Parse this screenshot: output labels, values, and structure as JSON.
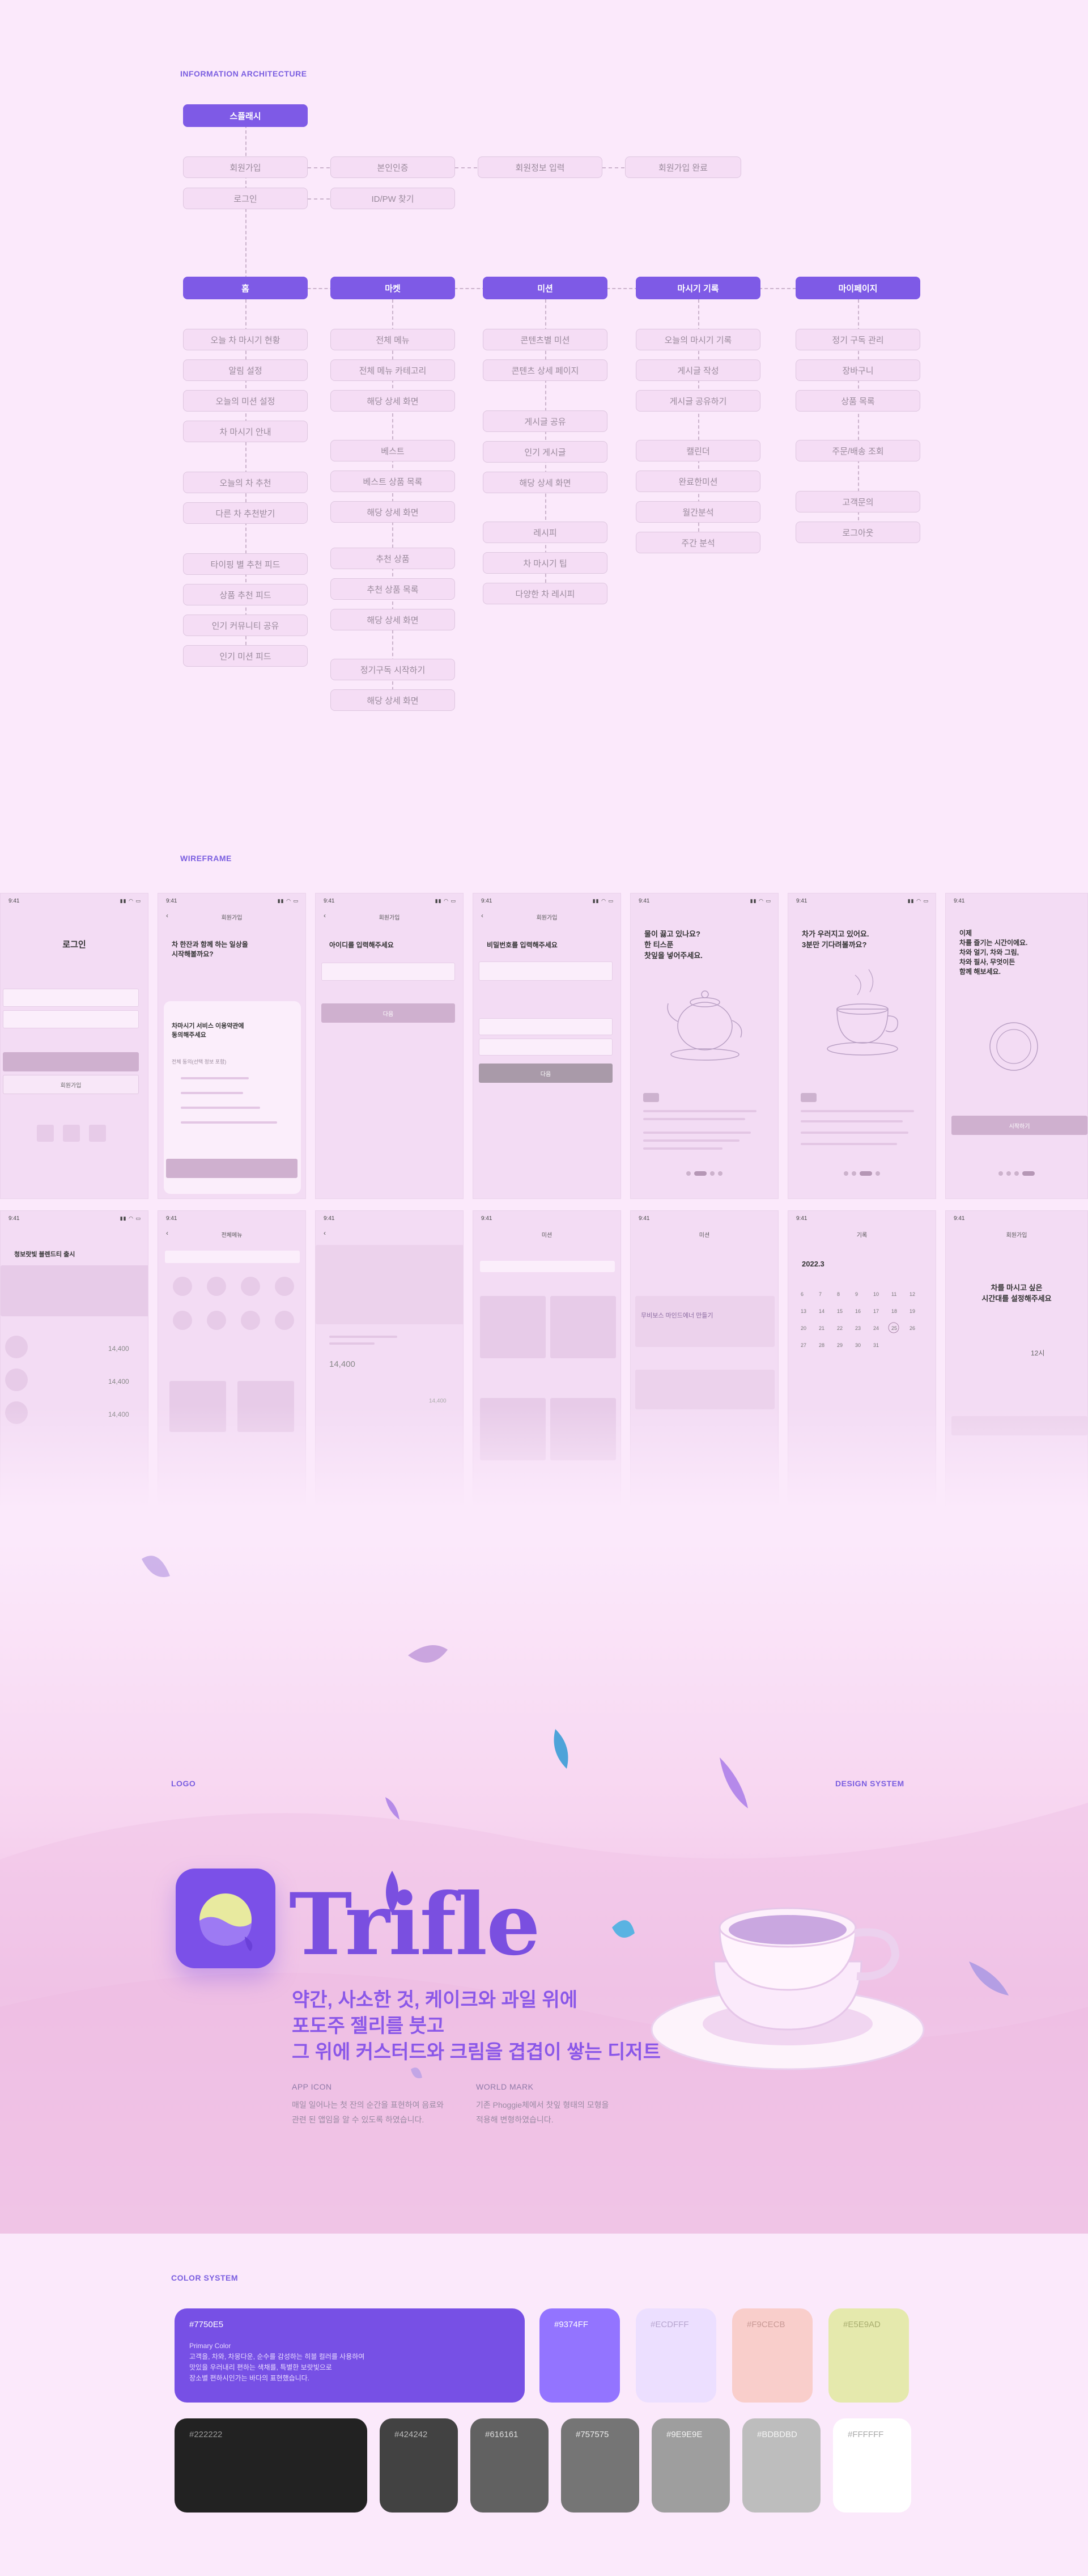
{
  "ia": {
    "label": "INFORMATION ARCHITECTURE",
    "splash": "스플래시",
    "auth_row1": [
      "회원가입",
      "본인인증",
      "회원정보 입력",
      "회원가입 완료"
    ],
    "auth_row2": [
      "로그인",
      "ID/PW 찾기"
    ],
    "columns": [
      {
        "head": "홈",
        "items": [
          "오늘 차 마시기 현황",
          "알림 설정",
          "오늘의 미션 설정",
          "차 마시기 안내",
          "오늘의 차 추천",
          "다른 차 추천받기",
          "타이핑 별 추천 피드",
          "상품 추천 피드",
          "인기 커뮤니티 공유",
          "인기 미션 피드"
        ]
      },
      {
        "head": "마켓",
        "items": [
          "전체 메뉴",
          "전체 메뉴 카테고리",
          "해당 상세 화면",
          "베스트",
          "베스트 상품 목록",
          "해당 상세 화면",
          "추천 상품",
          "추천 상품 목록",
          "해당 상세 화면",
          "정기구독 시작하기",
          "해당 상세 화면"
        ]
      },
      {
        "head": "미션",
        "items": [
          "콘텐츠별 미션",
          "콘텐츠 상세 페이지",
          "게시글 공유",
          "인기 게시글",
          "해당 상세 화면",
          "레시피",
          "차 마시기 팁",
          "다양한 차 레시피"
        ]
      },
      {
        "head": "마시기 기록",
        "items": [
          "오늘의 마시기 기록",
          "게시글 작성",
          "게시글 공유하기",
          "캘린더",
          "완료한미션",
          "월간분석",
          "주간 분석"
        ]
      },
      {
        "head": "마이페이지",
        "items": [
          "정기 구독 관리",
          "장바구니",
          "상품 목록",
          "주문/배송 조회",
          "고객문의",
          "로그아웃"
        ]
      }
    ]
  },
  "wireframe": {
    "label": "WIREFRAME",
    "time": "9:41",
    "login_title": "로그인",
    "signup": "회원가입",
    "join_title": "차 한잔과 함께 하는 일상을\n시작해볼까요?",
    "terms_title": "차마시기 서비스 이용약관에\n동의해주세요",
    "terms_all": "전체 동의(선택 정보 포함)",
    "id_title": "아이디를 입력해주세요",
    "pw_title": "비밀번호를 입력해주세요",
    "next": "다음",
    "onb1": "물이 끓고 있나요?\n한 티스푼\n찻잎을 넣어주세요.",
    "onb2": "차가 우러지고 있어요.\n3분만 기다려볼까요?",
    "onb3": "이제\n차를 즐기는 시간이에요.\n차와 얼기, 차와 그림,\n차와 필사, 무엇이든\n함께 해보세요.",
    "start": "시작하기",
    "market_title": "전체메뉴",
    "mission_title": "미션",
    "record_title": "기록",
    "record_month": "2022.3",
    "alarm_title": "차를 마시고 싶은\n시간대를 설정해주세요",
    "alarm_time": "12시",
    "home_title": "청보랏빛 블렌드티 출시",
    "price": "14,400",
    "mission_card": "무비보스 마인드에너 만들기"
  },
  "logo": {
    "label": "LOGO",
    "ds_label": "DESIGN SYSTEM",
    "wordmark": "Trifle",
    "tagline": "약간, 사소한 것, 케이크와 과일 위에\n포도주 젤리를 붓고\n그 위에 커스터드와 크림을 겹겹이 쌓는 디저트",
    "app_icon_h": "APP ICON",
    "app_icon_b": "매일 일어나는 첫 잔의 순간을 표현하여 음료와\n관련 된 앱임을 알 수 있도록 하였습니다.",
    "wordmark_h": "WORLD MARK",
    "wordmark_b": "기존 Phoggie체에서 찻잎 형태의 모형을\n적용해 변형하였습니다."
  },
  "colors": {
    "label": "COLOR SYSTEM",
    "primary": {
      "hex": "#7750E5",
      "sub": "Primary  Color\n고객을, 차와, 차몽다운, 순수를 감성하는 히블 컬러를 사용하여\n맛있을 우러내리 편하는 색채를, 특별한 보랏빛으로\n장소별 편하시인가는 바다의 표현했습니다."
    },
    "swatches_row1": [
      {
        "hex": "#9374FF",
        "color": "#9374ff",
        "text": "#ffffff"
      },
      {
        "hex": "#ECDFFF",
        "color": "#ecdfff",
        "text": "#b7a6cf"
      },
      {
        "hex": "#F9CECB",
        "color": "#f9cecb",
        "text": "#c99a96"
      },
      {
        "hex": "#E5E9AD",
        "color": "#e5e9ad",
        "text": "#a9ad70"
      }
    ],
    "swatches_row2": [
      {
        "hex": "#222222",
        "color": "#222222",
        "text": "#999999"
      },
      {
        "hex": "#424242",
        "color": "#424242",
        "text": "#bbbbbb"
      },
      {
        "hex": "#616161",
        "color": "#616161",
        "text": "#dddddd"
      },
      {
        "hex": "#757575",
        "color": "#757575",
        "text": "#eeeeee"
      },
      {
        "hex": "#9E9E9E",
        "color": "#9e9e9e",
        "text": "#f3f3f3"
      },
      {
        "hex": "#BDBDBD",
        "color": "#bdbdbd",
        "text": "#f5f5f5"
      },
      {
        "hex": "#FFFFFF",
        "color": "#ffffff",
        "text": "#aaaaaa"
      }
    ]
  }
}
